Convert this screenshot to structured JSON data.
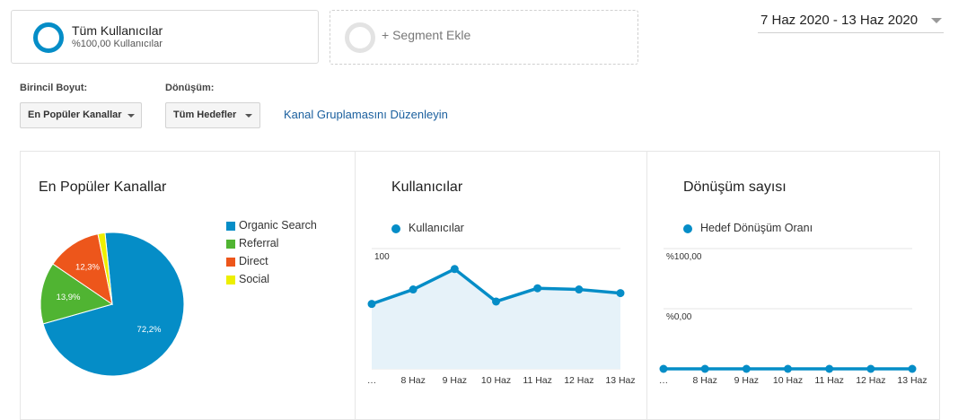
{
  "segments": {
    "active": {
      "name": "Tüm Kullanıcılar",
      "sub": "%100,00 Kullanıcılar"
    },
    "add_label": "+ Segment Ekle"
  },
  "date_range": "7 Haz 2020 - 13 Haz 2020",
  "controls": {
    "primary_dimension_label": "Birincil Boyut:",
    "primary_dimension_value": "En Popüler Kanallar",
    "conversion_label": "Dönüşüm:",
    "conversion_value": "Tüm Hedefler",
    "edit_link": "Kanal Gruplamasını Düzenleyin"
  },
  "colors": {
    "accent": "#058dc7",
    "organic": "#058dc7",
    "referral": "#50b432",
    "direct": "#ed561b",
    "social": "#edef00",
    "area_fill": "#e6f2f9"
  },
  "panels": {
    "channels_title": "En Popüler Kanallar",
    "users_title": "Kullanıcılar",
    "conversions_title": "Dönüşüm sayısı"
  },
  "chart_data": [
    {
      "type": "pie",
      "title": "En Popüler Kanallar",
      "categories": [
        "Organic Search",
        "Referral",
        "Direct",
        "Social"
      ],
      "values": [
        72.2,
        13.9,
        12.3,
        1.6
      ],
      "labels": [
        "72,2%",
        "13,9%",
        "12,3%",
        ""
      ],
      "colors": [
        "#058dc7",
        "#50b432",
        "#ed561b",
        "#edef00"
      ],
      "legend": "right"
    },
    {
      "type": "area",
      "title": "Kullanıcılar",
      "series": [
        {
          "name": "Kullanıcılar",
          "values": [
            54,
            66,
            83,
            56,
            67,
            66,
            63
          ]
        }
      ],
      "x": [
        "…",
        "8 Haz",
        "9 Haz",
        "10 Haz",
        "11 Haz",
        "12 Haz",
        "13 Haz"
      ],
      "yticks": [
        "100",
        "50"
      ],
      "ylim": [
        0,
        100
      ],
      "grid": true
    },
    {
      "type": "line",
      "title": "Dönüşüm sayısı",
      "series": [
        {
          "name": "Hedef Dönüşüm Oranı",
          "values": [
            0,
            0,
            0,
            0,
            0,
            0,
            0
          ]
        }
      ],
      "x": [
        "…",
        "8 Haz",
        "9 Haz",
        "10 Haz",
        "11 Haz",
        "12 Haz",
        "13 Haz"
      ],
      "yticks": [
        "%100,00",
        "%0,00"
      ],
      "ylim": [
        0,
        100
      ],
      "grid": true
    }
  ]
}
